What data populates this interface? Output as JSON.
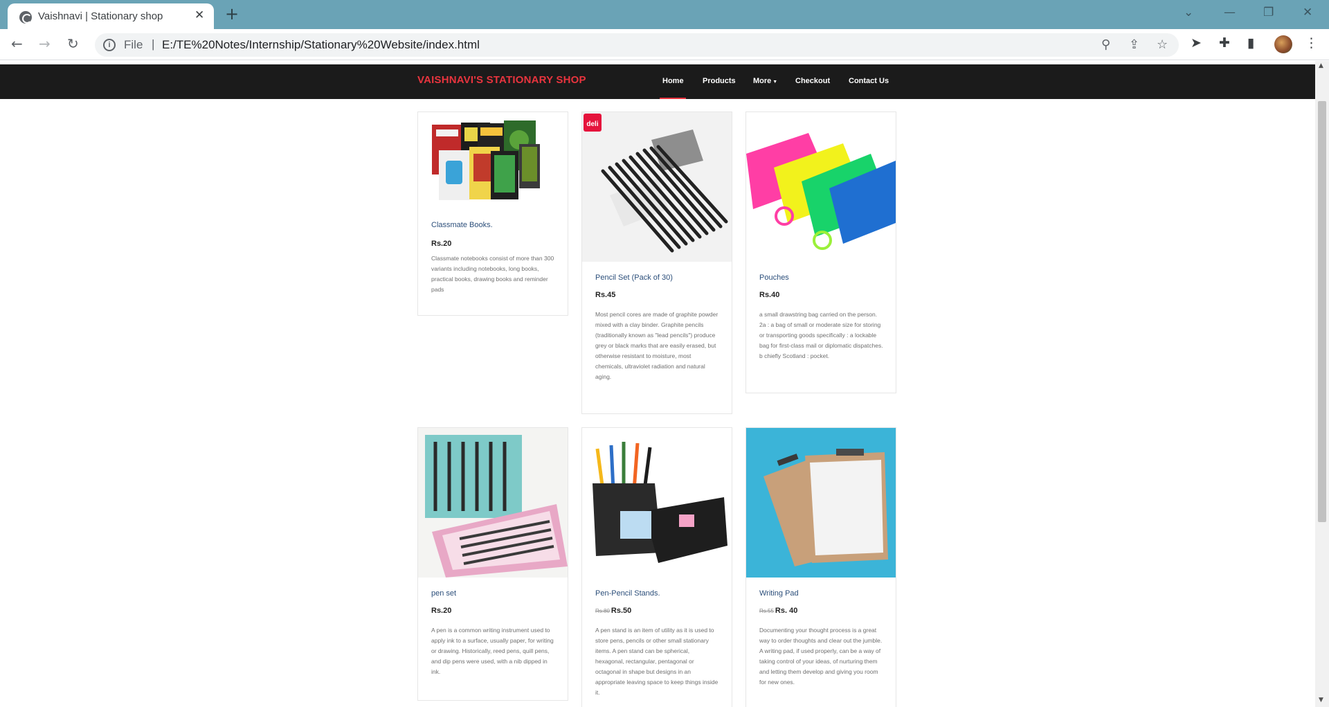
{
  "browser": {
    "tab_title": "Vaishnavi | Stationary shop",
    "url_scheme": "File",
    "url": "E:/TE%20Notes/Internship/Stationary%20Website/index.html"
  },
  "site": {
    "brand": "VAISHNAVI'S STATIONARY SHOP",
    "nav": [
      {
        "label": "Home"
      },
      {
        "label": "Products"
      },
      {
        "label": "More"
      },
      {
        "label": "Checkout"
      },
      {
        "label": "Contact Us"
      }
    ],
    "accent_color": "#e8343e"
  },
  "products": [
    {
      "title": "Classmate Books.",
      "price": "Rs.20",
      "old_price": "",
      "desc": "Classmate notebooks consist of more than 300 variants including notebooks, long books, practical books, drawing books and reminder pads"
    },
    {
      "title": "Pencil Set (Pack of 30)",
      "price": "Rs.45",
      "old_price": "",
      "badge": "deli",
      "desc": "Most pencil cores are made of graphite powder mixed with a clay binder. Graphite pencils (traditionally known as \"lead pencils\") produce grey or black marks that are easily erased, but otherwise resistant to moisture, most chemicals, ultraviolet radiation and natural aging."
    },
    {
      "title": "Pouches",
      "price": "Rs.40",
      "old_price": "",
      "desc": "a small drawstring bag carried on the person. 2a : a bag of small or moderate size for storing or transporting goods specifically : a lockable bag for first-class mail or diplomatic dispatches. b chiefly Scotland : pocket."
    },
    {
      "title": "pen set",
      "price": "Rs.20",
      "old_price": "",
      "desc": "A pen is a common writing instrument used to apply ink to a surface, usually paper, for writing or drawing. Historically, reed pens, quill pens, and dip pens were used, with a nib dipped in ink."
    },
    {
      "title": "Pen-Pencil Stands.",
      "price": "Rs.50",
      "old_price": "Rs.80",
      "desc": "A pen stand is an item of utility as it is used to store pens, pencils or other small stationary items. A pen stand can be spherical, hexagonal, rectangular, pentagonal or octagonal in shape but designs in an appropriate leaving space to keep things inside it."
    },
    {
      "title": "Writing Pad",
      "price": "Rs. 40",
      "old_price": "Rs.55",
      "desc": "Documenting your thought process is a great way to order thoughts and clear out the jumble. A writing pad, if used properly, can be a way of taking control of your ideas, of nurturing them and letting them develop and giving you room for new ones."
    }
  ]
}
